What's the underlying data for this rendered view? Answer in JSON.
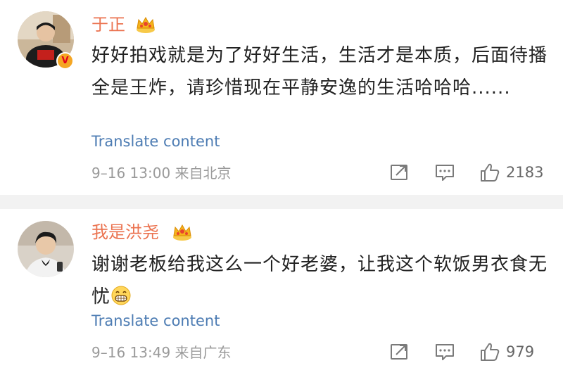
{
  "posts": [
    {
      "username": "于正",
      "verified_badge": "V",
      "content": "好好拍戏就是为了好好生活，生活才是本质，后面待播全是王炸，请珍惜现在平静安逸的生活哈哈哈......",
      "translate_label": "Translate content",
      "meta": "9–16 13:00 来自北京",
      "likes": "2183",
      "icons": [
        "crown-badge-icon",
        "repost-icon",
        "comment-icon",
        "thumbs-up-icon"
      ]
    },
    {
      "username": "我是洪尧",
      "content": "谢谢老板给我这么一个好老婆，让我这个软饭男衣食无忧",
      "emoji": "grinning-face-emoji",
      "translate_label": "Translate content",
      "meta": "9–16 13:49 来自广东",
      "likes": "979",
      "icons": [
        "crown-badge-icon",
        "repost-icon",
        "comment-icon",
        "thumbs-up-icon"
      ]
    }
  ],
  "colors": {
    "username": "#eb7350",
    "link": "#4d7cb3",
    "meta": "#9a9a9a",
    "divider": "#f2f2f2"
  }
}
